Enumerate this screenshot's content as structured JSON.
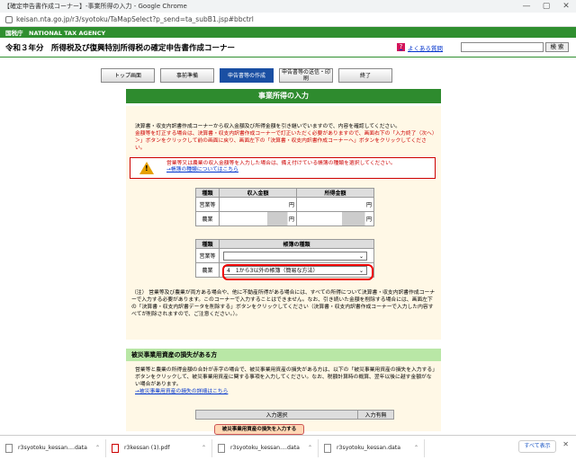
{
  "window": {
    "title": "【確定申告書作成コーナー】-事業所得の入力 - Google Chrome",
    "url": "keisan.nta.go.jp/r3/syotoku/TaMapSelect?p_send=ta_subB1.jsp#bbctrl",
    "ctrl_min": "—",
    "ctrl_max": "▢",
    "ctrl_close": "✕"
  },
  "agency": {
    "label": "国税庁　NATIONAL TAX AGENCY"
  },
  "header": {
    "title": "令和３年分　所得税及び復興特別所得税の確定申告書作成コーナー",
    "faq_icon": "?",
    "faq": "よくある質問",
    "search_button": "検 索"
  },
  "steps": [
    {
      "label": "トップ画面"
    },
    {
      "label": "事前準備"
    },
    {
      "label": "申告書等の作成"
    },
    {
      "label": "申告書等の送信・印刷"
    },
    {
      "label": "終了"
    }
  ],
  "page_title": "事業所得の入力",
  "intro": {
    "line1": "決算書・収支内訳書作成コーナーから収入金額及び所得金額を引き継いでいますので、内容を確認してください。",
    "line2_red": "金額等を訂正する場合は、決算書・収支内訳書作成コーナーで訂正いただく必要がありますので、画面右下の「入力終了（次へ）＞」ボタンをクリックして前の画面に戻り、画面左下の「決算書・収支内訳書作成コーナーへ」ボタンをクリックしてください。"
  },
  "notice": {
    "warn_mark": "!",
    "message": "営業等又は農業の収入金額等を入力した場合は、備え付けている帳簿の種類を選択してください。",
    "link": "→帳簿の種類についてはこちら"
  },
  "income_table": {
    "headers": [
      "種類",
      "収入金額",
      "所得金額"
    ],
    "rows": [
      {
        "type": "営業等",
        "income": "円",
        "profit": "円"
      },
      {
        "type": "農業",
        "income": "円",
        "profit": "円"
      }
    ]
  },
  "ledger_table": {
    "headers": [
      "種類",
      "帳簿の種類"
    ],
    "rows": [
      {
        "type": "営業等",
        "value": ""
      },
      {
        "type": "農業",
        "value": "4　1から3以外の帳簿（簡易な方法）"
      }
    ]
  },
  "note": {
    "label": "（注）",
    "text": "営業等及び農業が両方ある場合や、他に不動産所得がある場合には、すべての所得について決算書・収支内訳書作成コーナーで入力する必要があります。このコーナーで入力することはできません。なお、引き続いた金額を削除する場合には、画面左下の「決算書・収支内訳書データを削除する」ボタンをクリックしてください（決算書・収支内訳書作成コーナーで入力した内容すべてが削除されますので、ご注意ください。）。"
  },
  "disaster": {
    "title": "被災事業用資産の損失がある方",
    "text": "営業等と農業の所得金額の合計が赤字の場合で、被災事業用資産の損失がある方は、以下の「被災事業用資産の損失を入力する」ボタンをクリックして、被災事業用資産に関する事項を入力してください。なお、税額計算時の概算、翌年以後に越す金額がない場合があります。",
    "link": "→被災事業用資産の損失の詳細はこちら",
    "table_headers": [
      "入力選択",
      "入力有無"
    ],
    "button": "被災事業用資産の損失を入力する"
  },
  "downloads": [
    {
      "name": "r3syotoku_kessan....data",
      "icon": "file-icon"
    },
    {
      "name": "r3kessan (1).pdf",
      "icon": "pdf-icon"
    },
    {
      "name": "r3syotoku_kessan....data",
      "icon": "file-icon"
    },
    {
      "name": "r3syotoku_kessan.data",
      "icon": "file-icon"
    }
  ],
  "download_bar": {
    "show_all": "すべて表示",
    "close": "✕",
    "chevron": "⌃"
  },
  "colors": {
    "nta_green": "#2f8f2f",
    "step_active": "#1a4fa3",
    "alert_red": "#cc0000"
  }
}
